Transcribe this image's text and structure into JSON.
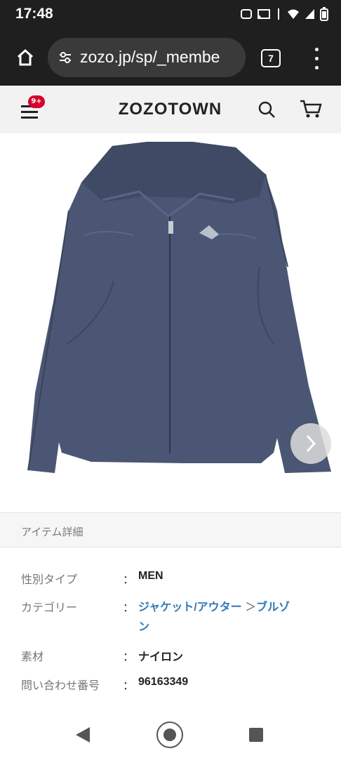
{
  "status": {
    "time": "17:48"
  },
  "browser": {
    "url": "zozo.jp/sp/_membe",
    "tab_count": "7"
  },
  "site": {
    "logo": "ZOZOTOWN",
    "cart_badge": "9+"
  },
  "product": {
    "image_alt": "Navy zip jacket",
    "jacket_color": "#4a5674"
  },
  "details": {
    "section_title": "アイテム詳細",
    "rows": [
      {
        "label": "性別タイプ",
        "colon": "：",
        "value": "MEN"
      },
      {
        "label": "カテゴリー",
        "colon": "：",
        "value_parts": [
          "ジャケット/アウター",
          "＞",
          "ブルゾ",
          "ン"
        ]
      },
      {
        "label": "素材",
        "colon": "：",
        "value": "ナイロン"
      },
      {
        "label": "問い合わせ番号",
        "colon": "：",
        "value": "96163349"
      }
    ]
  }
}
